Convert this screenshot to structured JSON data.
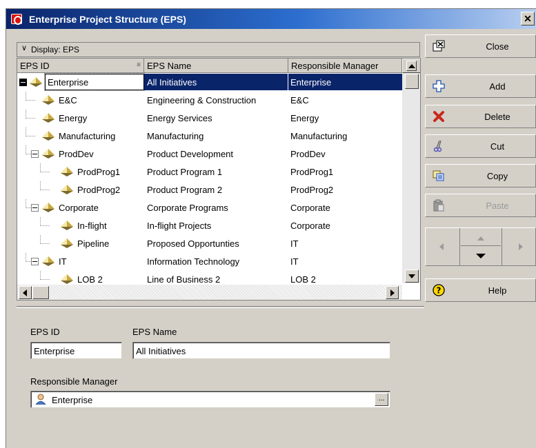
{
  "window": {
    "title": "Enterprise Project Structure (EPS)",
    "close_glyph": "✕"
  },
  "display_bar": {
    "label": "Display: EPS"
  },
  "columns": {
    "eps_id": "EPS ID",
    "eps_name": "EPS Name",
    "manager": "Responsible Manager"
  },
  "rows": [
    {
      "id": "Enterprise",
      "name": "All Initiatives",
      "manager": "Enterprise",
      "level": 0,
      "expander": "minus-dark",
      "selected": true
    },
    {
      "id": "E&C",
      "name": "Engineering & Construction",
      "manager": "E&C",
      "level": 1,
      "expander": ""
    },
    {
      "id": "Energy",
      "name": "Energy Services",
      "manager": "Energy",
      "level": 1,
      "expander": ""
    },
    {
      "id": "Manufacturing",
      "name": "Manufacturing",
      "manager": "Manufacturing",
      "level": 1,
      "expander": ""
    },
    {
      "id": "ProdDev",
      "name": "Product Development",
      "manager": "ProdDev",
      "level": 1,
      "expander": "minus"
    },
    {
      "id": "ProdProg1",
      "name": "Product Program 1",
      "manager": "ProdProg1",
      "level": 2,
      "expander": ""
    },
    {
      "id": "ProdProg2",
      "name": "Product Program 2",
      "manager": "ProdProg2",
      "level": 2,
      "expander": ""
    },
    {
      "id": "Corporate",
      "name": "Corporate Programs",
      "manager": "Corporate",
      "level": 1,
      "expander": "minus"
    },
    {
      "id": "In-flight",
      "name": "In-flight Projects",
      "manager": "Corporate",
      "level": 2,
      "expander": ""
    },
    {
      "id": "Pipeline",
      "name": "Proposed Opportunties",
      "manager": "IT",
      "level": 2,
      "expander": ""
    },
    {
      "id": "IT",
      "name": "Information Technology",
      "manager": "IT",
      "level": 1,
      "expander": "minus"
    },
    {
      "id": "LOB 2",
      "name": "Line of Business 2",
      "manager": "LOB 2",
      "level": 2,
      "expander": ""
    }
  ],
  "details": {
    "eps_id_label": "EPS ID",
    "eps_id_value": "Enterprise",
    "eps_name_label": "EPS Name",
    "eps_name_value": "All Initiatives",
    "manager_label": "Responsible Manager",
    "manager_value": "Enterprise",
    "browse_label": "..."
  },
  "buttons": {
    "close": "Close",
    "add": "Add",
    "delete": "Delete",
    "cut": "Cut",
    "copy": "Copy",
    "paste": "Paste",
    "help": "Help"
  },
  "icons": {
    "close": "close-window-icon",
    "add": "plus-icon",
    "delete": "red-x-icon",
    "cut": "scissors-icon",
    "copy": "copy-icon",
    "paste": "paste-icon",
    "help": "help-question-icon"
  },
  "colors": {
    "selection": "#0a246a",
    "diamond": "#e8d27a",
    "delete_x": "#c8281e",
    "help": "#ffd700"
  }
}
